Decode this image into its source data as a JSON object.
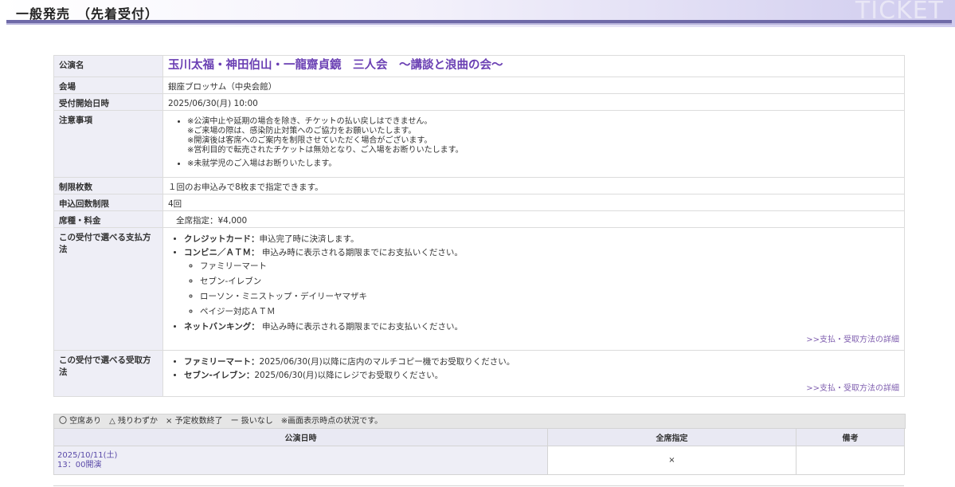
{
  "header": {
    "title": "一般発売　（先着受付）",
    "logo_text": "TICKET"
  },
  "info": {
    "performance_label": "公演名",
    "performance_value": "玉川太福・神田伯山・一龍齋貞鏡　三人会　〜講談と浪曲の会〜",
    "venue_label": "会場",
    "venue_value": "銀座ブロッサム（中央会館）",
    "start_label": "受付開始日時",
    "start_value": "2025/06/30(月) 10:00",
    "notes_label": "注意事項",
    "notes": [
      "※公演中止や延期の場合を除き、チケットの払い戻しはできません。",
      "※ご来場の際は、感染防止対策へのご協力をお願いいたします。",
      "※開演後は客席へのご案内を制限させていただく場合がございます。",
      "※営利目的で転売されたチケットは無効となり、ご入場をお断りいたします。",
      "※未就学児のご入場はお断りいたします。"
    ],
    "limit_label": "制限枚数",
    "limit_value": "１回のお申込みで8枚まで指定できます。",
    "apply_limit_label": "申込回数制限",
    "apply_limit_value": "4回",
    "seat_label": "席種・料金",
    "seat_value": "全席指定：¥4,000",
    "payment_label": "この受付で選べる支払方法",
    "payment": {
      "credit_name": "クレジットカード：",
      "credit_desc": "申込完了時に決済します。",
      "cvs_name": "コンビニ／ＡＴＭ：",
      "cvs_desc": " 申込み時に表示される期限までにお支払いください。",
      "cvs_options": [
        "ファミリーマート",
        "セブン-イレブン",
        "ローソン・ミニストップ・デイリーヤマザキ",
        "ペイジー対応ＡＴＭ"
      ],
      "net_name": "ネットバンキング：",
      "net_desc": " 申込み時に表示される期限までにお支払いください。",
      "detail_link": ">>支払・受取方法の詳細"
    },
    "receive_label": "この受付で選べる受取方法",
    "receive": {
      "fm_name": "ファミリーマート：",
      "fm_desc": "2025/06/30(月)以降に店内のマルチコピー機でお受取りください。",
      "se_name": "セブン-イレブン：",
      "se_desc": "2025/06/30(月)以降にレジでお受取りください。",
      "detail_link": ">>支払・受取方法の詳細"
    }
  },
  "legend": "〇 空席あり　△ 残りわずか　× 予定枚数終了　ー 扱いなし　※画面表示時点の状況です。",
  "performance_table": {
    "headers": [
      "公演日時",
      "全席指定",
      "備考"
    ],
    "rows": [
      {
        "date": "2025/10/11(土)",
        "time": "13：00開演",
        "status": "×",
        "note": ""
      }
    ]
  }
}
